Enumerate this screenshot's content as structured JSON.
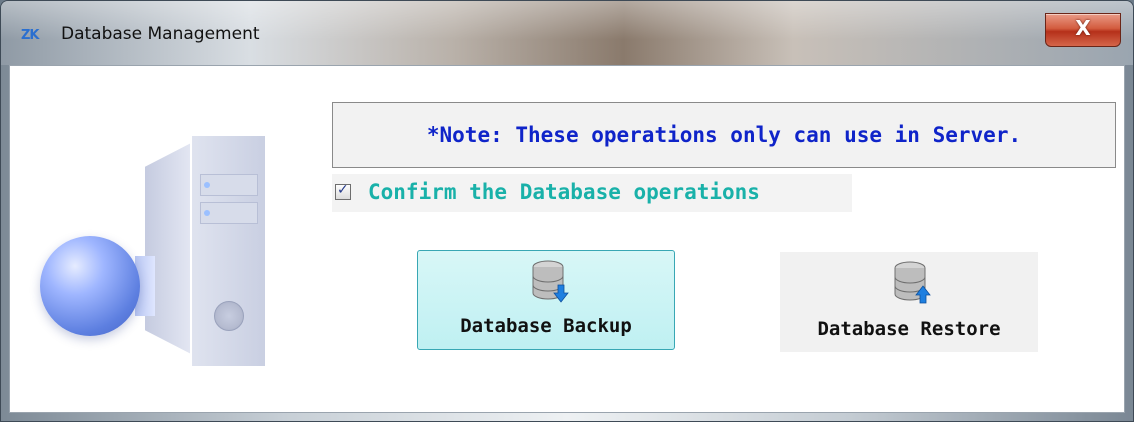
{
  "window": {
    "app_logo": "ZK",
    "title": "Database Management",
    "close_label": "X"
  },
  "icons": {
    "illustration": "server-globe-illustration",
    "backup_icon": "database-download-icon",
    "restore_icon": "database-upload-icon",
    "checkbox_check": "checkmark-icon"
  },
  "note": {
    "text": "*Note: These operations only can use in Server."
  },
  "confirm": {
    "checked": true,
    "label": "Confirm the Database operations"
  },
  "buttons": {
    "backup_label": "Database Backup",
    "restore_label": "Database Restore"
  },
  "colors": {
    "note_text": "#0f24c9",
    "confirm_text": "#19b1a9",
    "backup_bg": "#c9f3f4",
    "close_button": "#c84a2e"
  }
}
